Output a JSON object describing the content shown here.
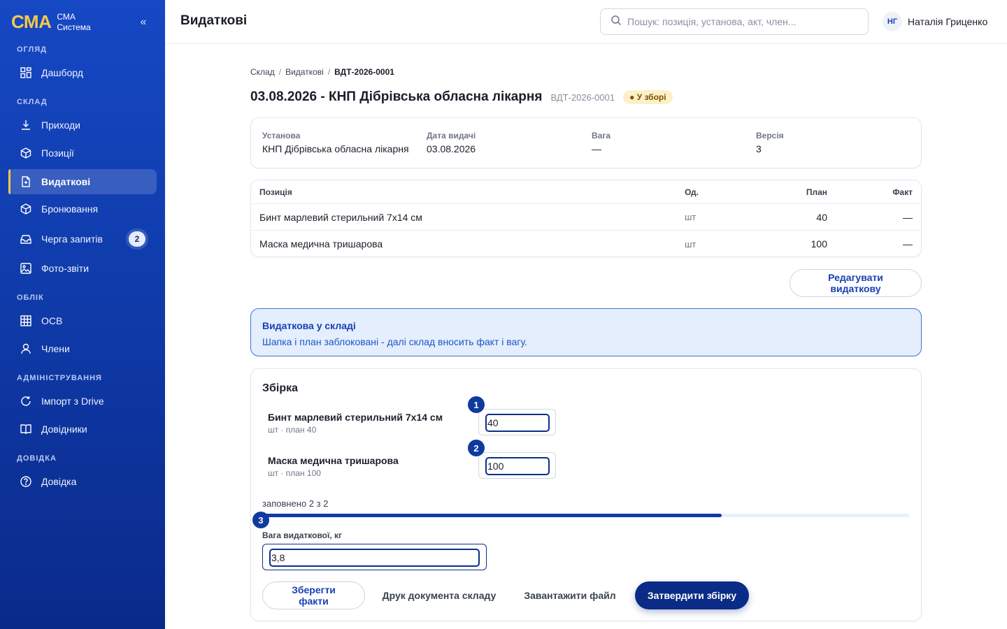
{
  "app": {
    "logo": "СМА",
    "name_line1": "СМА",
    "name_line2": "Система",
    "collapse_glyph": "«"
  },
  "sidebar": {
    "sections": [
      "Огляд",
      "Склад",
      "Облік",
      "Адміністрування",
      "Довідка"
    ],
    "items": [
      {
        "label": "Дашборд",
        "icon": "dashboard-icon"
      },
      {
        "label": "Приходи",
        "icon": "download-icon"
      },
      {
        "label": "Позиції",
        "icon": "box-icon"
      },
      {
        "label": "Видаткові",
        "icon": "document-icon",
        "active": true
      },
      {
        "label": "Бронювання",
        "icon": "box-icon"
      },
      {
        "label": "Черга запитів",
        "icon": "inbox-icon",
        "badge": "2"
      },
      {
        "label": "Фото-звіти",
        "icon": "image-icon"
      },
      {
        "label": "ОСВ",
        "icon": "grid-icon"
      },
      {
        "label": "Члени",
        "icon": "user-icon"
      },
      {
        "label": "Імпорт з Drive",
        "icon": "refresh-icon"
      },
      {
        "label": "Довідники",
        "icon": "book-icon"
      },
      {
        "label": "Довідка",
        "icon": "help-icon"
      }
    ]
  },
  "header": {
    "title": "Видаткові",
    "search_placeholder": "Пошук: позиція, установа, акт, член...",
    "user_initials": "НГ",
    "user_name": "Наталія Гриценко"
  },
  "breadcrumb": [
    "Склад",
    "Видаткові",
    "ВДТ-2026-0001"
  ],
  "document": {
    "title": "03.08.2026 - КНП Дібрівська обласна лікарня",
    "code": "ВДТ-2026-0001",
    "status": "● У зборі",
    "info": [
      {
        "label": "Установа",
        "value": "КНП Дібрівська обласна лікарня"
      },
      {
        "label": "Дата видачі",
        "value": "03.08.2026"
      },
      {
        "label": "Вага",
        "value": "—"
      },
      {
        "label": "Версія",
        "value": "3"
      }
    ]
  },
  "table": {
    "headers": {
      "name": "Позиція",
      "unit": "Од.",
      "plan": "План",
      "fact": "Факт"
    },
    "rows": [
      {
        "name": "Бинт марлевий стерильний 7х14 см",
        "unit": "шт",
        "plan": "40",
        "fact": "—"
      },
      {
        "name": "Маска медична тришарова",
        "unit": "шт",
        "plan": "100",
        "fact": "—"
      }
    ]
  },
  "edit_button": "Редагувати видаткову",
  "notice": {
    "title": "Видаткова у складі",
    "text": "Шапка і план заблоковані - далі склад вносить факт і вагу."
  },
  "assembly": {
    "title": "Збірка",
    "items": [
      {
        "marker": "1",
        "name": "Бинт марлевий стерильний 7х14 см",
        "sub": "шт · план 40",
        "value": "40"
      },
      {
        "marker": "2",
        "name": "Маска медична тришарова",
        "sub": "шт · план 100",
        "value": "100"
      }
    ],
    "progress_label": "заповнено 2 з 2",
    "progress_fraction": 0.71,
    "weight_marker": "3",
    "weight_label": "Вага видаткової, кг",
    "weight_value": "3,8",
    "buttons": {
      "save": "Зберегти факти",
      "print": "Друк документа складу",
      "upload": "Завантажити файл",
      "approve": "Затвердити збірку"
    }
  }
}
